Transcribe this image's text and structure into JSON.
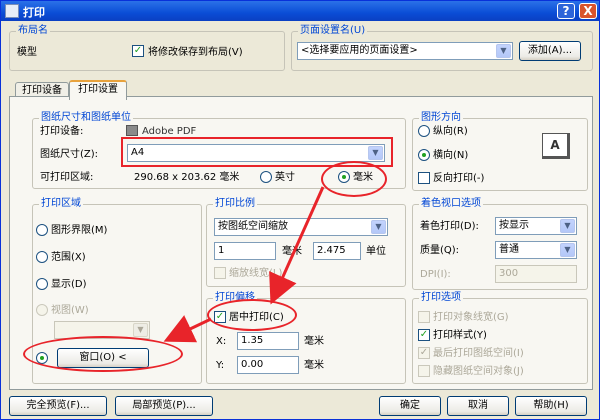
{
  "window": {
    "title": "打印",
    "help_label": "?",
    "close_label": "X"
  },
  "layout_group": {
    "label": "布局名",
    "name": "模型",
    "save_changes_label": "将修改保存到布局(V)",
    "save_changes_checked": true
  },
  "page_setup_group": {
    "label": "页面设置名(U)",
    "combo_value": "<选择要应用的页面设置>",
    "add_button": "添加(A)..."
  },
  "tabs": [
    {
      "label": "打印设备"
    },
    {
      "label": "打印设置"
    }
  ],
  "paper_group": {
    "label": "图纸尺寸和图纸单位",
    "device_label": "打印设备:",
    "device_value": "Adobe PDF",
    "size_label": "图纸尺寸(Z):",
    "size_value": "A4",
    "area_label": "可打印区域:",
    "area_value": "290.68 x 203.62 毫米",
    "inch_label": "英寸",
    "mm_label": "毫米"
  },
  "orientation_group": {
    "label": "图形方向",
    "portrait": "纵向(R)",
    "landscape": "横向(N)",
    "reverse": "反向打印(-)",
    "preview_glyph": "A"
  },
  "area_group": {
    "label": "打印区域",
    "limits": "图形界限(M)",
    "extents": "范围(X)",
    "display": "显示(D)",
    "view": "视图(W)",
    "window_button": "窗口(O) <"
  },
  "scale_group": {
    "label": "打印比例",
    "combo_value": "按图纸空间缩放",
    "value1": "1",
    "unit1": "毫米",
    "value2": "2.475",
    "unit2": "单位",
    "lineweights": "缩放线宽(L)"
  },
  "shaded_group": {
    "label": "着色视口选项",
    "shade_label": "着色打印(D):",
    "shade_value": "按显示",
    "quality_label": "质量(Q):",
    "quality_value": "普通",
    "dpi_label": "DPI(I):",
    "dpi_value": "300"
  },
  "offset_group": {
    "label": "打印偏移",
    "center_label": "居中打印(C)",
    "x_label": "X:",
    "x_value": "1.35",
    "x_unit": "毫米",
    "y_label": "Y:",
    "y_value": "0.00",
    "y_unit": "毫米"
  },
  "options_group": {
    "label": "打印选项",
    "items": [
      "打印对象线宽(G)",
      "打印样式(Y)",
      "最后打印图纸空间(I)",
      "隐藏图纸空间对象(J)"
    ]
  },
  "footer": {
    "full_preview": "完全预览(F)...",
    "partial_preview": "局部预览(P)...",
    "ok": "确定",
    "cancel": "取消",
    "help": "帮助(H)"
  }
}
